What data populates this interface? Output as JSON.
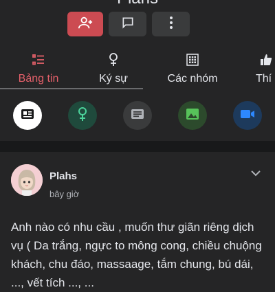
{
  "profile": {
    "name_partial": "Plahs"
  },
  "actions": {
    "add_friend_icon": "person-add-icon",
    "message_icon": "message-icon",
    "more_icon": "more-vertical-icon",
    "add_color": "#cc4b52",
    "secondary_color": "#3a3b3c"
  },
  "tabs": [
    {
      "label": "Bảng tin",
      "icon": "list-icon",
      "active": true
    },
    {
      "label": "Ký sự",
      "icon": "female-icon",
      "active": false
    },
    {
      "label": "Các nhóm",
      "icon": "grid-icon",
      "active": false
    },
    {
      "label": "Thí",
      "icon": "thumbs-up-icon",
      "active": false
    }
  ],
  "quick_actions": [
    {
      "icon": "news-icon",
      "color": "#ffffff"
    },
    {
      "icon": "female-icon",
      "color": "#1f4a3c"
    },
    {
      "icon": "note-icon",
      "color": "#3a3b3c"
    },
    {
      "icon": "image-icon",
      "color": "#2c4a2c"
    },
    {
      "icon": "video-icon",
      "color": "#1d3a5c"
    }
  ],
  "post": {
    "author": "Plahs",
    "time": "bây giờ",
    "text": "Anh nào có nhu cầu , muốn thư giãn riêng dịch vụ ( Da trắng, ngực to mông cong, chiều chuộng khách, chu đáo, massaage, tắm chung, bú dái, ..., vết tích ..., ..."
  },
  "colors": {
    "accent": "#e4606a",
    "background": "#252526"
  }
}
